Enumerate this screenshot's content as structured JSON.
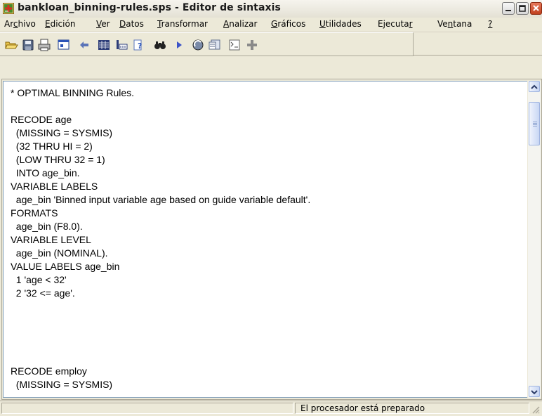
{
  "window": {
    "title": "bankloan_binning-rules.sps - Editor de sintaxis",
    "app_icon": "spss-syntax-icon"
  },
  "menu": {
    "items": [
      {
        "pre": "Ar",
        "accel": "c",
        "post": "hivo"
      },
      {
        "pre": "",
        "accel": "E",
        "post": "dición"
      },
      {
        "pre": "",
        "accel": "V",
        "post": "er"
      },
      {
        "pre": "",
        "accel": "D",
        "post": "atos"
      },
      {
        "pre": "",
        "accel": "T",
        "post": "ransformar"
      },
      {
        "pre": "",
        "accel": "A",
        "post": "nalizar"
      },
      {
        "pre": "",
        "accel": "G",
        "post": "ráficos"
      },
      {
        "pre": "",
        "accel": "U",
        "post": "tilidades"
      },
      {
        "pre": "Ejecuta",
        "accel": "r",
        "post": ""
      },
      {
        "pre": "Ve",
        "accel": "n",
        "post": "tana"
      },
      {
        "pre": "",
        "accel": "?",
        "post": ""
      }
    ]
  },
  "toolbar": {
    "icons": [
      "open-folder-icon",
      "save-icon",
      "print-icon",
      "dialog-recall-icon",
      "undo-icon",
      "goto-data-icon",
      "variables-icon",
      "help-icon",
      "find-icon",
      "run-icon",
      "syntax-help-icon",
      "designate-window-icon",
      "toggle-comment-icon",
      "add-icon"
    ]
  },
  "editor": {
    "lines": [
      "* OPTIMAL BINNING Rules.",
      "",
      "RECODE age",
      "  (MISSING = SYSMIS)",
      "  (32 THRU HI = 2)",
      "  (LOW THRU 32 = 1)",
      "  INTO age_bin.",
      "VARIABLE LABELS",
      "  age_bin 'Binned input variable age based on guide variable default'.",
      "FORMATS",
      "  age_bin (F8.0).",
      "VARIABLE LEVEL",
      "  age_bin (NOMINAL).",
      "VALUE LABELS age_bin",
      "  1 'age < 32'",
      "  2 '32 <= age'.",
      "",
      "RECODE employ",
      "  (MISSING = SYSMIS)"
    ]
  },
  "status": {
    "text": "El procesador  está preparado"
  }
}
